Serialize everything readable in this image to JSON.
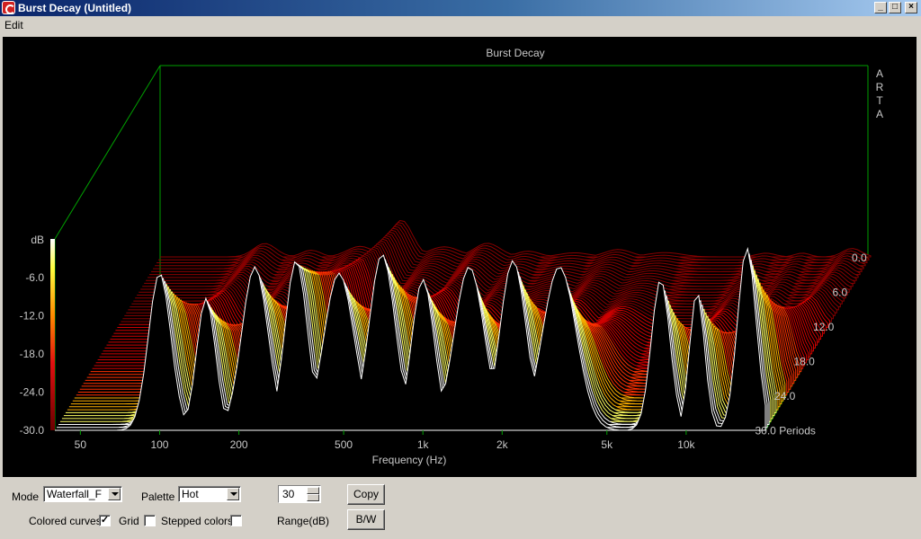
{
  "window": {
    "title": "Burst Decay  (Untitled)",
    "buttons": {
      "minimize": "_",
      "maximize": "□",
      "close": "×"
    }
  },
  "menu": {
    "items": [
      "Edit"
    ]
  },
  "chart_data": {
    "type": "waterfall",
    "title": "Burst Decay",
    "brand": "ARTA",
    "xlabel": "Frequency (Hz)",
    "ylabel": "dB",
    "zlabel": "Periods",
    "x_scale": "log",
    "xlim": [
      40,
      20000
    ],
    "ylim": [
      -30,
      0
    ],
    "zlim": [
      0,
      30
    ],
    "x_ticks": [
      {
        "value": 50,
        "label": "50"
      },
      {
        "value": 100,
        "label": "100"
      },
      {
        "value": 200,
        "label": "200"
      },
      {
        "value": 500,
        "label": "500"
      },
      {
        "value": 1000,
        "label": "1k"
      },
      {
        "value": 2000,
        "label": "2k"
      },
      {
        "value": 5000,
        "label": "5k"
      },
      {
        "value": 10000,
        "label": "10k"
      }
    ],
    "y_ticks": [
      "-6.0",
      "-12.0",
      "-18.0",
      "-24.0",
      "-30.0"
    ],
    "z_ticks": [
      "0.0",
      "6.0",
      "12.0",
      "18.0",
      "24.0",
      "30.0 Periods"
    ],
    "slices": 60,
    "palette": "Hot",
    "peaks": [
      {
        "freq": 100,
        "level": -5,
        "width": 0.06
      },
      {
        "freq": 150,
        "level": -9,
        "width": 0.05
      },
      {
        "freq": 230,
        "level": -4,
        "width": 0.07
      },
      {
        "freq": 330,
        "level": -3,
        "width": 0.06
      },
      {
        "freq": 480,
        "level": -5,
        "width": 0.08
      },
      {
        "freq": 700,
        "level": -2,
        "width": 0.07
      },
      {
        "freq": 1000,
        "level": -6,
        "width": 0.06
      },
      {
        "freq": 1500,
        "level": -4,
        "width": 0.08
      },
      {
        "freq": 2200,
        "level": -3,
        "width": 0.07
      },
      {
        "freq": 3300,
        "level": -4,
        "width": 0.09
      },
      {
        "freq": 8000,
        "level": -6,
        "width": 0.05
      },
      {
        "freq": 11000,
        "level": -8,
        "width": 0.04
      },
      {
        "freq": 17000,
        "level": -1,
        "width": 0.05
      }
    ]
  },
  "controls": {
    "mode_label": "Mode",
    "mode_value": "Waterfall_F",
    "palette_label": "Palette",
    "palette_value": "Hot",
    "range_value": "30",
    "range_label": "Range(dB)",
    "copy_label": "Copy",
    "bw_label": "B/W",
    "colored_curves_label": "Colored curves",
    "colored_curves_checked": "✓",
    "grid_label": "Grid",
    "grid_checked": "",
    "stepped_colors_label": "Stepped colors",
    "stepped_colors_checked": ""
  }
}
